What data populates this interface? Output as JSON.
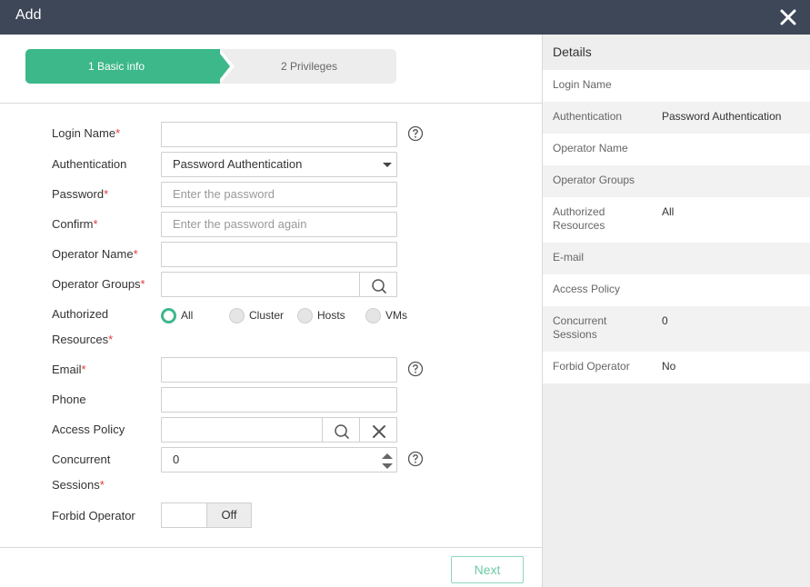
{
  "window": {
    "title": "Add"
  },
  "steps": [
    {
      "label": "1 Basic info",
      "active": true
    },
    {
      "label": "2 Privileges",
      "active": false
    }
  ],
  "form": {
    "login_name": {
      "label": "Login Name",
      "value": ""
    },
    "authentication": {
      "label": "Authentication",
      "value": "Password Authentication"
    },
    "password": {
      "label": "Password",
      "placeholder": "Enter the password"
    },
    "confirm": {
      "label": "Confirm",
      "placeholder": "Enter the password again"
    },
    "operator_name": {
      "label": "Operator Name",
      "value": ""
    },
    "operator_groups": {
      "label": "Operator Groups",
      "value": ""
    },
    "authorized_resources": {
      "label_line1": "Authorized",
      "label_line2": "Resources",
      "options": [
        "All",
        "Cluster",
        "Hosts",
        "VMs"
      ],
      "selected": "All"
    },
    "email": {
      "label": "Email",
      "value": ""
    },
    "phone": {
      "label": "Phone",
      "value": ""
    },
    "access_policy": {
      "label": "Access Policy",
      "value": ""
    },
    "concurrent_sessions": {
      "label_line1": "Concurrent",
      "label_line2": "Sessions",
      "value": "0"
    },
    "forbid_operator": {
      "label": "Forbid Operator",
      "state": "Off"
    },
    "required_mark": "*"
  },
  "footer": {
    "next_label": "Next"
  },
  "details": {
    "title": "Details",
    "rows": [
      {
        "key": "Login Name",
        "value": ""
      },
      {
        "key": "Authentication",
        "value": "Password Authentication"
      },
      {
        "key": "Operator Name",
        "value": ""
      },
      {
        "key": "Operator Groups",
        "value": ""
      },
      {
        "key": "Authorized Resources",
        "value": "All"
      },
      {
        "key": "E-mail",
        "value": ""
      },
      {
        "key": "Access Policy",
        "value": ""
      },
      {
        "key": "Concurrent Sessions",
        "value": "0"
      },
      {
        "key": "Forbid Operator",
        "value": "No"
      }
    ]
  },
  "colors": {
    "titlebar": "#3d4758",
    "accent": "#3cb88a",
    "required": "#e23b3b"
  },
  "icons": [
    "close-icon",
    "help-icon",
    "search-icon",
    "clear-icon",
    "chevron-down-icon",
    "spinner-up-icon",
    "spinner-down-icon"
  ]
}
